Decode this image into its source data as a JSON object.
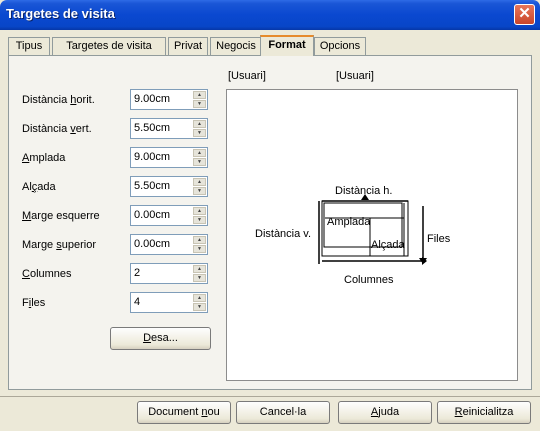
{
  "window": {
    "title": "Targetes de visita",
    "close_glyph": "✕"
  },
  "tabs": [
    {
      "label": "Tipus"
    },
    {
      "label": "Targetes de visita"
    },
    {
      "label": "Privat"
    },
    {
      "label": "Negocis"
    },
    {
      "label": "Format",
      "active": true
    },
    {
      "label": "Opcions"
    }
  ],
  "fields": [
    {
      "label_pre": "Distància ",
      "label_key": "h",
      "label_post": "orit.",
      "value": "9.00cm"
    },
    {
      "label_pre": "Distància ",
      "label_key": "v",
      "label_post": "ert.",
      "value": "5.50cm"
    },
    {
      "label_pre": "",
      "label_key": "A",
      "label_post": "mplada",
      "value": "9.00cm"
    },
    {
      "label_pre": "Al",
      "label_key": "ç",
      "label_post": "ada",
      "value": "5.50cm"
    },
    {
      "label_pre": "",
      "label_key": "M",
      "label_post": "arge esquerre",
      "value": "0.00cm"
    },
    {
      "label_pre": "Marge ",
      "label_key": "s",
      "label_post": "uperior",
      "value": "0.00cm"
    },
    {
      "label_pre": "",
      "label_key": "C",
      "label_post": "olumnes",
      "value": "2"
    },
    {
      "label_pre": "F",
      "label_key": "i",
      "label_post": "les",
      "value": "4"
    }
  ],
  "save_button": {
    "pre": "",
    "key": "D",
    "post": "esa..."
  },
  "preview": {
    "header_left": "[Usuari]",
    "header_right": "[Usuari]",
    "distancia_h": "Distància h.",
    "distancia_v": "Distància v.",
    "amplada": "Amplada",
    "alcada": "Alçada",
    "files": "Files",
    "columnes": "Columnes"
  },
  "buttons": {
    "new_doc": {
      "pre": "Document ",
      "key": "n",
      "post": "ou"
    },
    "cancel": {
      "pre": "Cancel·la",
      "key": "",
      "post": ""
    },
    "help": {
      "pre": "",
      "key": "A",
      "post": "juda"
    },
    "reset": {
      "pre": "",
      "key": "R",
      "post": "einicialitza"
    }
  },
  "icons": {
    "spin_up": "spin-up-arrow-icon",
    "spin_down": "spin-down-arrow-icon",
    "close": "close-icon"
  },
  "colors": {
    "title_bar": "#0a48d0",
    "dialog_bg": "#ece9d8",
    "active_tab_accent": "#e68b2c"
  }
}
